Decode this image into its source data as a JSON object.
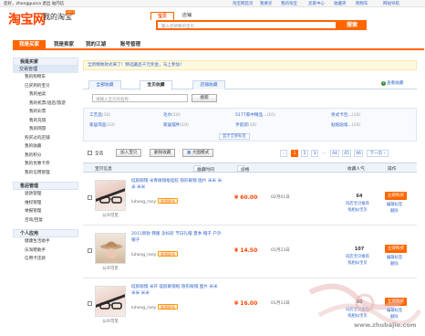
{
  "topbar": {
    "greeting": "您好，zhongguoca 退出 站内信",
    "links": [
      "淘宝网首页",
      "我要买",
      "我的淘宝",
      "卖家中心",
      "收藏夹",
      "购物车",
      "网站导航"
    ]
  },
  "header": {
    "logo": "淘宝网",
    "logo_sub": "我的淘宝",
    "logo_badge": "2011",
    "search_tabs": [
      "宝贝",
      "店铺"
    ],
    "search_placeholder": "输入您想要的宝贝",
    "search_button": "搜索"
  },
  "nav": [
    "我是买家",
    "我是卖家",
    "我的江湖",
    "账号管理"
  ],
  "sidebar": [
    {
      "head": "我是买家",
      "sub": "交易管理",
      "items": [
        {
          "label": "我的购物车",
          "level": 1
        },
        {
          "label": "已买到的宝贝",
          "level": 1
        },
        {
          "label": "我的拍卖",
          "level": 2
        },
        {
          "label": "我的机票/酒店/旅游",
          "level": 2
        },
        {
          "label": "我的彩票",
          "level": 2
        },
        {
          "label": "我的充值",
          "level": 2
        },
        {
          "label": "我的网游",
          "level": 2
        },
        {
          "label": "购买过的店铺",
          "level": 1
        },
        {
          "label": "我的收藏",
          "level": 1
        },
        {
          "label": "我的积分",
          "level": 1
        },
        {
          "label": "我的优惠卡券",
          "level": 1
        },
        {
          "label": "我的信用管理",
          "level": 1
        }
      ]
    },
    {
      "head": "售后管理",
      "items": [
        {
          "label": "退款管理",
          "level": 1
        },
        {
          "label": "维权管理",
          "level": 1
        },
        {
          "label": "举报管理",
          "level": 1
        },
        {
          "label": "咨询/回复",
          "level": 1
        }
      ]
    },
    {
      "head": "个人应用",
      "items": [
        {
          "label": "健康生活助手",
          "level": 1
        },
        {
          "label": "乐淘鞋助手",
          "level": 1
        },
        {
          "label": "信用卡还款",
          "level": 1
        }
      ]
    }
  ],
  "notice": "全新精致款式来了！精选藏品千元奖金，马上参加！",
  "fav_tabs": [
    "全部收藏",
    "宝贝收藏",
    "店铺收藏"
  ],
  "view_fav": "查看收藏",
  "fav_search_placeholder": "请输入宝贝的名称",
  "fav_search_button": "搜索",
  "categories": [
    {
      "name": "工艺品",
      "count": "(10)"
    },
    {
      "name": "毛巾",
      "count": "(10)"
    },
    {
      "name": "5177家中精品...",
      "count": "(10)"
    },
    {
      "name": "男式卡包...",
      "count": "(10)"
    },
    {
      "name": "家居饰品",
      "count": "(10)"
    },
    {
      "name": "家居摆件",
      "count": "(10)"
    },
    {
      "name": "手提袋",
      "count": "(10)"
    },
    {
      "name": "贴纸贴墙...",
      "count": "(10)"
    },
    {
      "name": "家居用品",
      "count": "(10)"
    },
    {
      "name": "饰品",
      "count": "(10)"
    },
    {
      "name": "其它",
      "count": "(10)"
    },
    {
      "name": "男式挎包...",
      "count": "(10)"
    }
  ],
  "show_all": "显示全部标签",
  "toolbar": {
    "select_all": "全选",
    "add_cart": "加入宝贝",
    "delete": "删除收藏",
    "big_mode": "大图模式",
    "pages": [
      "1",
      "2",
      "3",
      "...",
      "44",
      "45",
      "46"
    ],
    "next": "下一页"
  },
  "thead": {
    "info": "宝贝信息",
    "time": "收藏时间",
    "price": "价格",
    "popularity": "收藏人气",
    "ops": "操作"
  },
  "rows": [
    {
      "title": "硅胶眼镜 米青眼镜框硅胶 隐形眼镜 图片 米米 米米 米米",
      "seller": "luhong_rany",
      "wang": "和我联系",
      "publish": "公众可见",
      "price": "¥ 60.00",
      "time": "02月01日",
      "count": "64",
      "action1": "同店宝贝推荐",
      "action2": "找相似宝贝",
      "buy": "立即购买",
      "op1": "编辑标签",
      "op2": "删除"
    },
    {
      "title": "2011新款 韩版 孕妇装 节日礼帽 夏季 帽子 户外帽子",
      "seller": "luhong_rany",
      "wang": "和我联系",
      "publish": "公众可见",
      "price": "¥ 14.50",
      "time": "01月23日",
      "count": "107",
      "action1": "同店宝贝推荐",
      "action2": "找相似宝贝",
      "buy": "立即购买",
      "op1": "编辑标签",
      "op2": "删除"
    },
    {
      "title": "硅胶眼镜 米开 硅胶眼镜框 隐形眼镜 图片 米米 米米 米米",
      "seller": "luhong_rany",
      "wang": "和我联系",
      "publish": "公众可见",
      "price": "¥ 16.00",
      "time": "01月13日",
      "count": "90",
      "action1": "同店宝贝推荐",
      "action2": "找相似宝贝",
      "buy": "立即购买",
      "op1": "编辑标签",
      "op2": "删除"
    }
  ],
  "watermark": "www.zhubajie.com",
  "colors": {
    "brand": "#ff6600",
    "price": "#ff4400",
    "link": "#3366cc"
  }
}
